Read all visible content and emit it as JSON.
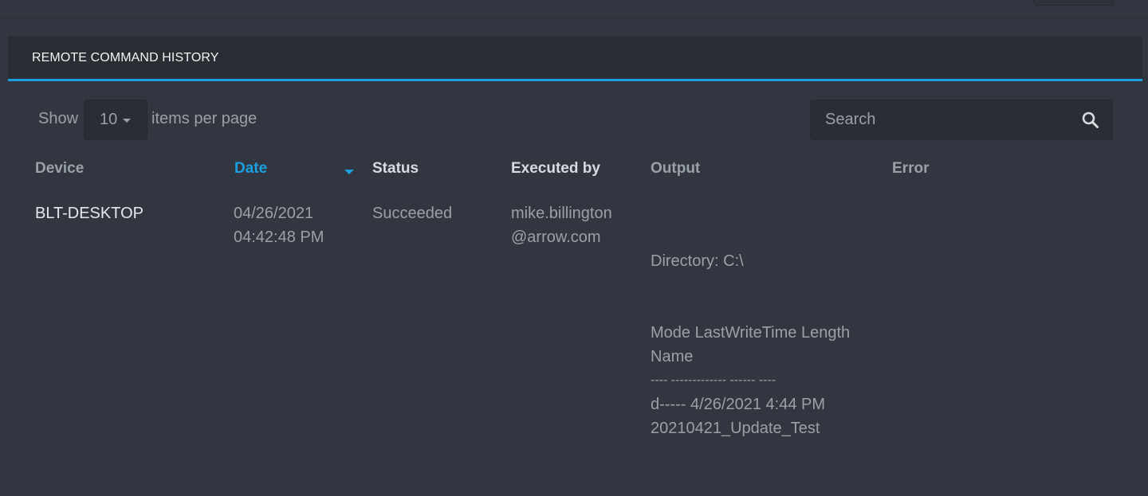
{
  "panel": {
    "title": "REMOTE COMMAND HISTORY"
  },
  "pagination": {
    "show_label": "Show",
    "page_size": "10",
    "items_per_page_label": "items per page"
  },
  "search": {
    "placeholder": "Search",
    "value": "",
    "icon": "search-icon"
  },
  "table": {
    "columns": [
      "Device",
      "Date",
      "Status",
      "Executed by",
      "Output",
      "Error"
    ],
    "sorted_column": "Date",
    "sort_direction": "descending",
    "rows": [
      {
        "device": "BLT-DESKTOP",
        "date": [
          "04/26/2021",
          "04:42:48 PM"
        ],
        "status": "Succeeded",
        "executed_by": [
          "mike.billington",
          "@arrow.com"
        ],
        "output": [
          "",
          "",
          "Directory: C:\\",
          "",
          "",
          "Mode LastWriteTime Length",
          "Name",
          "---- ------------- ------ ----",
          "d----- 4/26/2021 4:44 PM",
          "20210421_Update_Test"
        ],
        "error": ""
      }
    ]
  },
  "colors": {
    "background": "#323640",
    "header_background": "#2a2d33",
    "accent": "#1aa0e0",
    "text_muted": "#9aa0a8",
    "text_light": "#e6e9ec"
  }
}
